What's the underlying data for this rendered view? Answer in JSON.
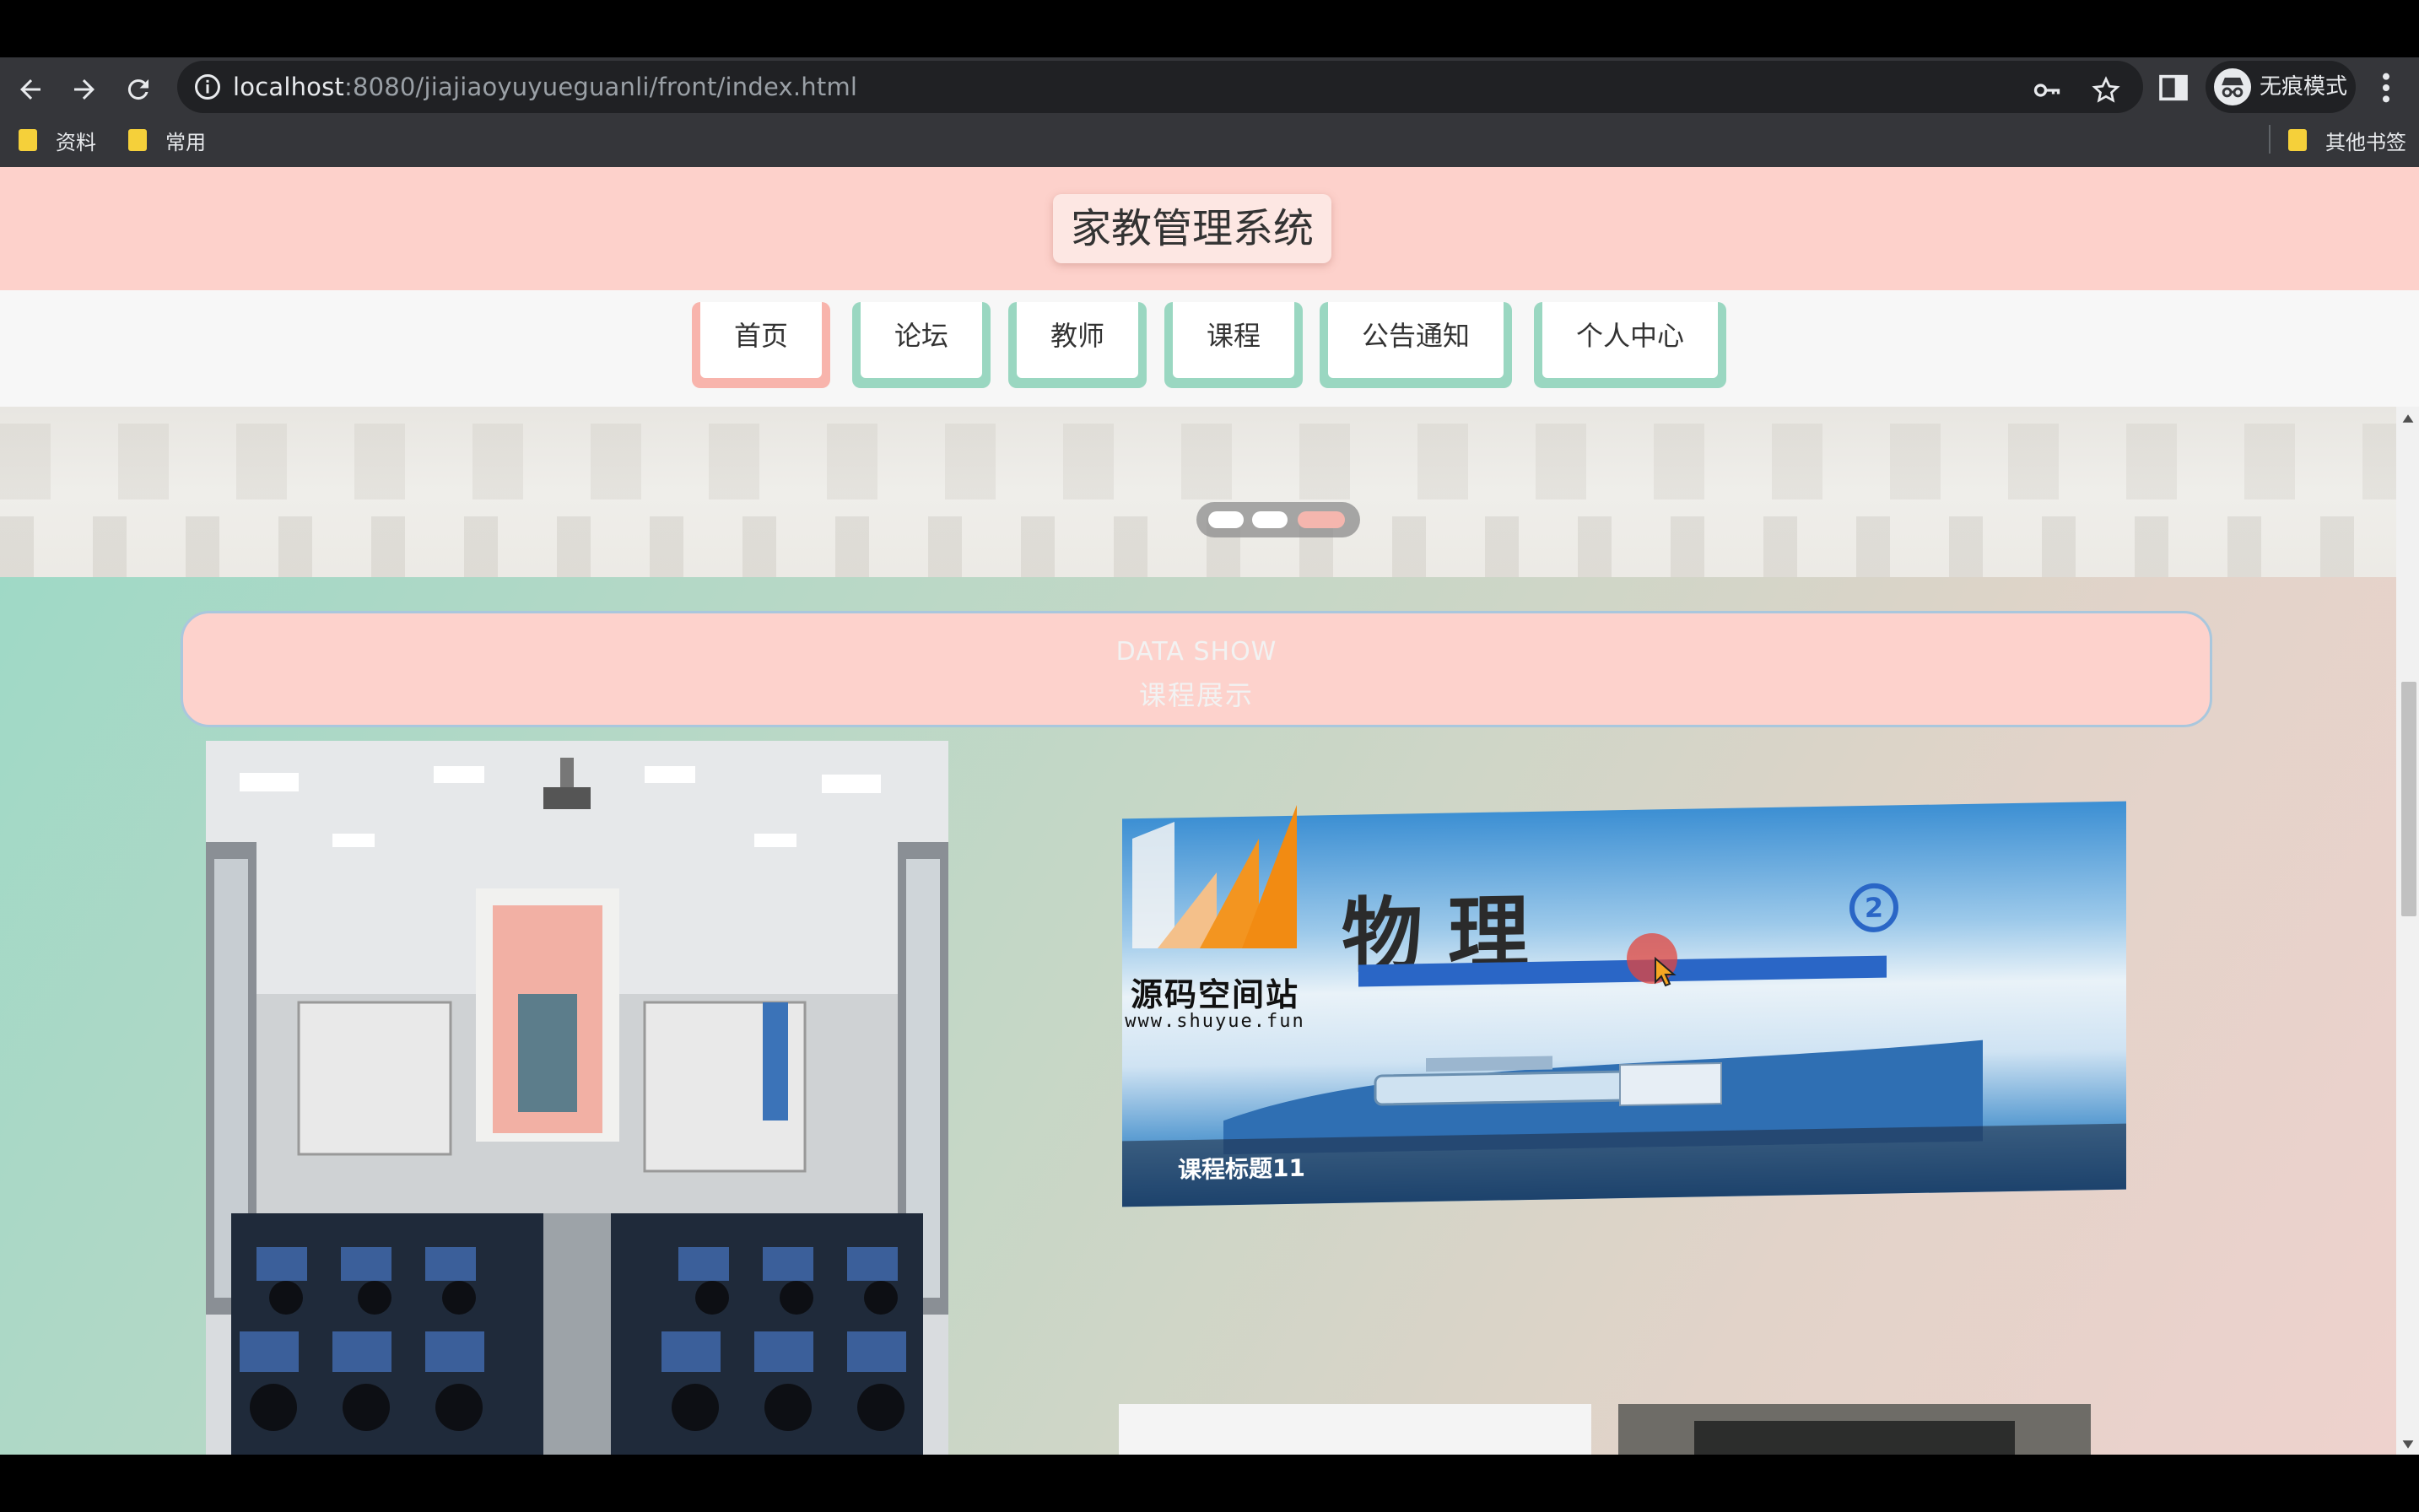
{
  "browser": {
    "url_host": "localhost",
    "url_rest": ":8080/jiajiaoyuyueguanli/front/index.html",
    "profile_label": "无痕模式",
    "bookmarks": [
      {
        "label": "资料"
      },
      {
        "label": "常用"
      }
    ],
    "other_bookmarks_label": "其他书签"
  },
  "site": {
    "title": "家教管理系统",
    "nav": [
      {
        "label": "首页",
        "active": true
      },
      {
        "label": "论坛",
        "active": false
      },
      {
        "label": "教师",
        "active": false
      },
      {
        "label": "课程",
        "active": false
      },
      {
        "label": "公告通知",
        "active": false
      },
      {
        "label": "个人中心",
        "active": false
      }
    ],
    "banner": {
      "slide_count": 3,
      "active_slide": 3
    }
  },
  "section": {
    "title_en": "DATA SHOW",
    "title_cn": "课程展示",
    "featured_caption": "课程标题11",
    "featured_cover_text": "物理",
    "featured_cover_badge": "2"
  },
  "watermark": {
    "name": "源码空间站",
    "url": "www.shuyue.fun"
  },
  "colors": {
    "header_pink": "#fdd1cb",
    "nav_green": "#9ad7c1",
    "nav_active_pink": "#f8b4ac",
    "section_green": "#9fd9c6",
    "browser_dark": "#35363a"
  }
}
